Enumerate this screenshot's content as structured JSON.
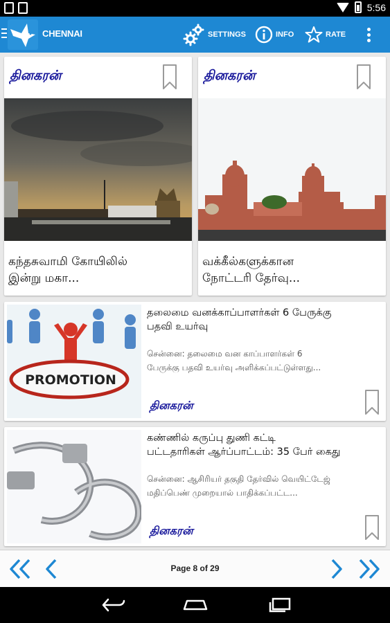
{
  "status_bar": {
    "time": "5:56"
  },
  "app_bar": {
    "title": "CHENNAI",
    "actions": {
      "settings": "SETTINGS",
      "info": "INFO",
      "rate": "RATE"
    }
  },
  "grid_cards": [
    {
      "source": "தினகரன்",
      "title_line1": "கந்தசுவாமி கோயிலில்",
      "title_line2": "இன்று மகா..."
    },
    {
      "source": "தினகரன்",
      "title_line1": "வக்கீல்களுக்கான",
      "title_line2": "நோட்டரி தேர்வு..."
    }
  ],
  "list_items": [
    {
      "title_line1": "தலைமை வனக்காப்பாளர்கள் 6 பேருக்கு",
      "title_line2": "பதவி உயர்வு",
      "snippet_line1": "சென்னை: தலைமை வன காப்பாளர்கள் 6",
      "snippet_line2": "பேருக்கு பதவி உயர்வு  அளிக்கப்பட்டுள்ளது...",
      "source": "தினகரன்",
      "image_text": "PROMOTION"
    },
    {
      "title_line1": "கண்ணில் கருப்பு துணி கட்டி",
      "title_line2": "பட்டதாரிகள் ஆர்ப்பாட்டம்: 35 பேர் கைது",
      "snippet_line1": "சென்னை: ஆசிரியர் தகுதி தேர்வில் வெயிட்டேஜ்",
      "snippet_line2": "மதிப்பெண்  முறையால் பாதிக்கப்பட்ட...",
      "source": "தினகரன்"
    }
  ],
  "pagination": {
    "label": "Page 8 of 29"
  },
  "colors": {
    "app_bar": "#1e88d3",
    "accent": "#1e88d3",
    "brand_text": "#1a1a9c"
  },
  "icons": [
    "pigeon-logo-icon",
    "gear-icon",
    "info-icon",
    "star-icon",
    "overflow-menu-icon",
    "bookmark-icon",
    "first-page-icon",
    "previous-page-icon",
    "next-page-icon",
    "last-page-icon",
    "back-icon",
    "home-icon",
    "recents-icon"
  ]
}
